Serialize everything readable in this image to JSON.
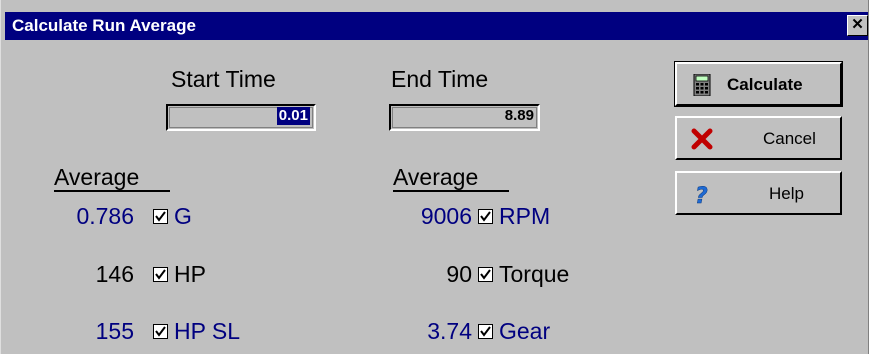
{
  "window": {
    "title": "Calculate Run Average"
  },
  "times": {
    "start_label": "Start Time",
    "start_value": "0.01",
    "end_label": "End Time",
    "end_value": "8.89"
  },
  "buttons": {
    "calculate": "Calculate",
    "cancel": "Cancel",
    "help": "Help"
  },
  "left_group": {
    "heading": "Average",
    "rows": [
      {
        "value": "0.786",
        "label": "G",
        "checked": true,
        "color": "#000080"
      },
      {
        "value": "146",
        "label": "HP",
        "checked": true,
        "color": "#000000"
      },
      {
        "value": "155",
        "label": "HP SL",
        "checked": true,
        "color": "#000080"
      }
    ]
  },
  "right_group": {
    "heading": "Average",
    "rows": [
      {
        "value": "9006",
        "label": "RPM",
        "checked": true,
        "color": "#000080"
      },
      {
        "value": "90",
        "label": "Torque",
        "checked": true,
        "color": "#000000"
      },
      {
        "value": "3.74",
        "label": "Gear",
        "checked": true,
        "color": "#000080"
      }
    ]
  },
  "icons": {
    "calculate": "calculator-icon",
    "cancel": "red-x-icon",
    "help": "question-mark-icon",
    "close": "close-icon"
  }
}
